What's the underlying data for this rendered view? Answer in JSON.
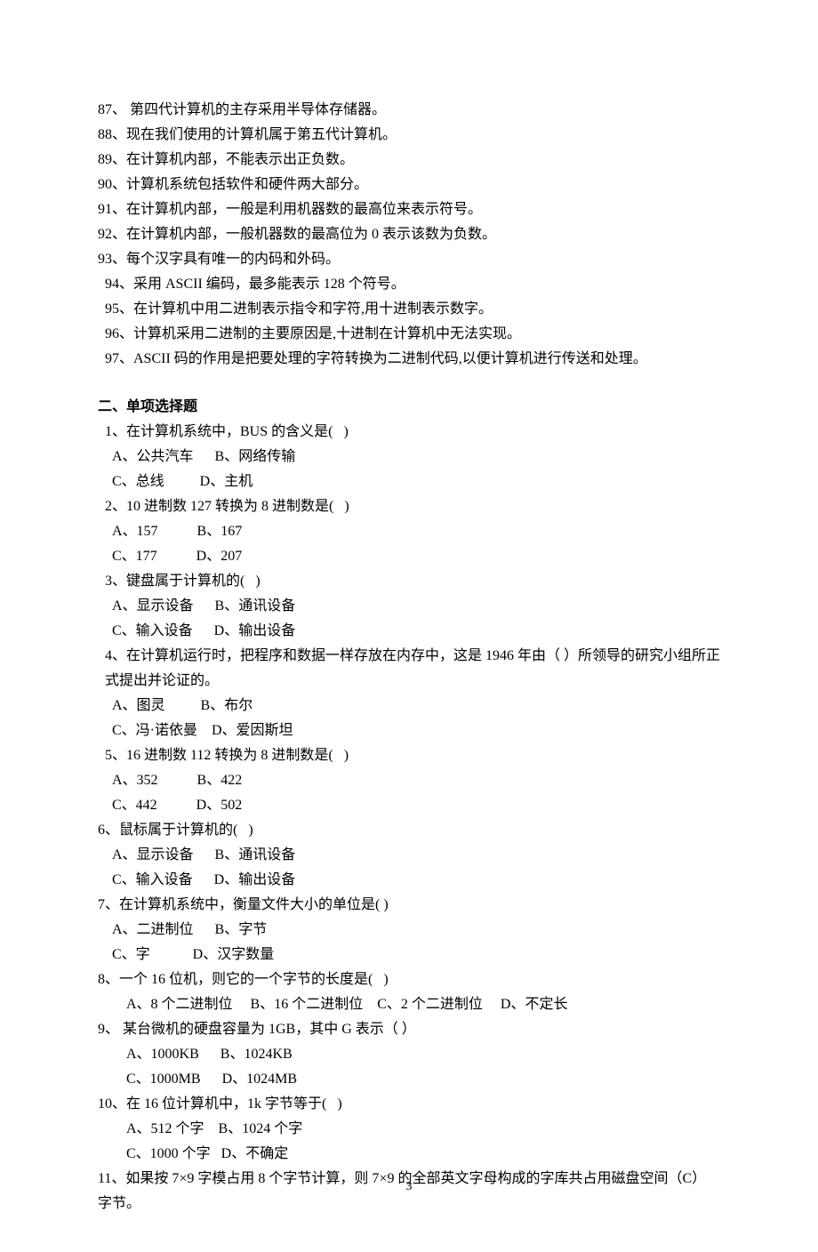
{
  "tf": {
    "q87": "87、 第四代计算机的主存采用半导体存储器。",
    "q88": "88、现在我们使用的计算机属于第五代计算机。",
    "q89": "89、在计算机内部，不能表示出正负数。",
    "q90": "90、计算机系统包括软件和硬件两大部分。",
    "q91": "91、在计算机内部，一般是利用机器数的最高位来表示符号。",
    "q92": "92、在计算机内部，一般机器数的最高位为 0 表示该数为负数。",
    "q93": "93、每个汉字具有唯一的内码和外码。",
    "q94": "94、采用 ASCII 编码，最多能表示 128 个符号。",
    "q95": "95、在计算机中用二进制表示指令和字符,用十进制表示数字。",
    "q96": "96、计算机采用二进制的主要原因是,十进制在计算机中无法实现。",
    "q97": "97、ASCII 码的作用是把要处理的字符转换为二进制代码,以便计算机进行传送和处理。"
  },
  "section2_title": "二、单项选择题",
  "mc": {
    "q1": {
      "stem": "1、在计算机系统中，BUS 的含义是(   )",
      "row1": "A、公共汽车      B、网络传输",
      "row2": "C、总线          D、主机"
    },
    "q2": {
      "stem": "2、10 进制数 127 转换为 8 进制数是(   )",
      "row1": "A、157           B、167",
      "row2": "C、177           D、207"
    },
    "q3": {
      "stem": "3、键盘属于计算机的(   )",
      "row1": "A、显示设备      B、通讯设备",
      "row2": "C、输入设备      D、输出设备"
    },
    "q4": {
      "stem": "4、在计算机运行时，把程序和数据一样存放在内存中，这是 1946 年由（   ）所领导的研究小组所正式提出并论证的。",
      "row1": "A、图灵          B、布尔",
      "row2": "C、冯·诺依曼    D、爱因斯坦"
    },
    "q5": {
      "stem": "5、16 进制数 112 转换为 8 进制数是(   )",
      "row1": "A、352           B、422",
      "row2": "C、442           D、502"
    },
    "q6": {
      "stem": "6、鼠标属于计算机的(   )",
      "row1": "A、显示设备      B、通讯设备",
      "row2": "C、输入设备      D、输出设备"
    },
    "q7": {
      "stem": "7、在计算机系统中，衡量文件大小的单位是( )",
      "row1": "A、二进制位      B、字节",
      "row2": "C、字            D、汉字数量"
    },
    "q8": {
      "stem": "8、一个 16 位机，则它的一个字节的长度是(   )",
      "row1": "A、8 个二进制位     B、16 个二进制位    C、2 个二进制位     D、不定长"
    },
    "q9": {
      "stem": "9、 某台微机的硬盘容量为 1GB，其中 G 表示（ ）",
      "row1": "A、1000KB      B、1024KB",
      "row2": "C、1000MB      D、1024MB"
    },
    "q10": {
      "stem": "10、在 16 位计算机中，1k 字节等于(   )",
      "row1": "A、512 个字    B、1024 个字",
      "row2": "C、1000 个字   D、不确定"
    },
    "q11": {
      "stem": "11、如果按 7×9 字模占用 8 个字节计算，则 7×9 的全部英文字母构成的字库共占用磁盘空间（C）字节。"
    }
  },
  "page_number": "3"
}
